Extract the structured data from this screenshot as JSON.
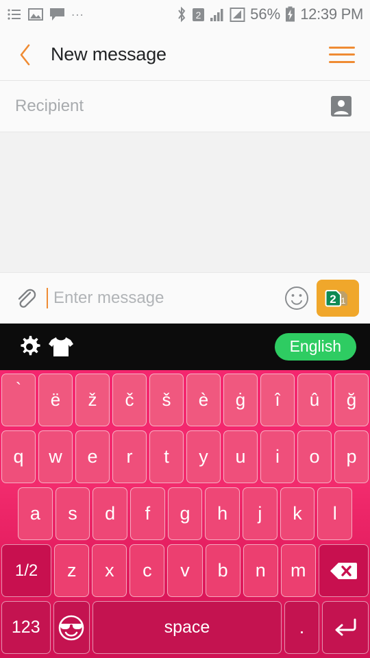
{
  "statusbar": {
    "left_icons": [
      "list-icon",
      "image-icon",
      "message-icon",
      "overflow-dots-icon"
    ],
    "right_icons": [
      "bluetooth-icon",
      "sim2-icon",
      "signal-icon",
      "signal-secondary-icon",
      "battery-charging-icon"
    ],
    "overflow": "...",
    "battery_percent": "56%",
    "time": "12:39 PM"
  },
  "appbar": {
    "back_icon": "chevron-left-icon",
    "title": "New message",
    "menu_icon": "hamburger-menu-icon",
    "accent_color": "#ef8b33"
  },
  "recipient": {
    "placeholder": "Recipient",
    "value": "",
    "contact_icon": "contact-picker-icon"
  },
  "compose": {
    "attach_icon": "paperclip-icon",
    "placeholder": "Enter message",
    "value": "",
    "emoji_icon": "smiley-face-icon",
    "send": {
      "icon": "sim2-send-icon",
      "sim_label": "2",
      "sim_secondary_label": "1",
      "background": "#f0a72b",
      "sim_color": "#0e8a53"
    }
  },
  "keyboard_toolbar": {
    "settings_icon": "gear-icon",
    "theme_icon": "tshirt-icon",
    "language_label": "English",
    "language_color": "#2ecc62",
    "background": "#0c0c0c"
  },
  "keyboard": {
    "theme_colors": {
      "background_top": "#f4266e",
      "background_bottom": "#cf1254",
      "key_light": "#f0587f",
      "key_dark": "#c41350"
    },
    "rows": [
      {
        "name": "accent-row",
        "keys": [
          {
            "label": "`",
            "name": "key-grave"
          },
          {
            "label": "ë",
            "name": "key-e-diaeresis"
          },
          {
            "label": "ž",
            "name": "key-z-caron"
          },
          {
            "label": "č",
            "name": "key-c-caron"
          },
          {
            "label": "š",
            "name": "key-s-caron"
          },
          {
            "label": "è",
            "name": "key-e-grave"
          },
          {
            "label": "ġ",
            "name": "key-g-dot"
          },
          {
            "label": "î",
            "name": "key-i-circumflex"
          },
          {
            "label": "û",
            "name": "key-u-circumflex"
          },
          {
            "label": "ğ",
            "name": "key-g-breve"
          }
        ]
      },
      {
        "name": "qwerty-row",
        "keys": [
          {
            "label": "q",
            "name": "key-q"
          },
          {
            "label": "w",
            "name": "key-w"
          },
          {
            "label": "e",
            "name": "key-e"
          },
          {
            "label": "r",
            "name": "key-r"
          },
          {
            "label": "t",
            "name": "key-t"
          },
          {
            "label": "y",
            "name": "key-y"
          },
          {
            "label": "u",
            "name": "key-u"
          },
          {
            "label": "i",
            "name": "key-i"
          },
          {
            "label": "o",
            "name": "key-o"
          },
          {
            "label": "p",
            "name": "key-p"
          }
        ]
      },
      {
        "name": "asdf-row",
        "keys": [
          {
            "label": "a",
            "name": "key-a"
          },
          {
            "label": "s",
            "name": "key-s"
          },
          {
            "label": "d",
            "name": "key-d"
          },
          {
            "label": "f",
            "name": "key-f"
          },
          {
            "label": "g",
            "name": "key-g"
          },
          {
            "label": "h",
            "name": "key-h"
          },
          {
            "label": "j",
            "name": "key-j"
          },
          {
            "label": "k",
            "name": "key-k"
          },
          {
            "label": "l",
            "name": "key-l"
          }
        ]
      },
      {
        "name": "zxcv-row",
        "keys": [
          {
            "label": "1/2",
            "name": "key-page-toggle"
          },
          {
            "label": "z",
            "name": "key-z"
          },
          {
            "label": "x",
            "name": "key-x"
          },
          {
            "label": "c",
            "name": "key-c"
          },
          {
            "label": "v",
            "name": "key-v"
          },
          {
            "label": "b",
            "name": "key-b"
          },
          {
            "label": "n",
            "name": "key-n"
          },
          {
            "label": "m",
            "name": "key-m"
          },
          {
            "label": "",
            "name": "key-backspace",
            "icon": "backspace-icon"
          }
        ]
      },
      {
        "name": "bottom-row",
        "keys": [
          {
            "label": "123",
            "name": "key-numeric"
          },
          {
            "label": "",
            "name": "key-emoji",
            "icon": "sunglasses-emoji-icon"
          },
          {
            "label": "space",
            "name": "key-space"
          },
          {
            "label": ".",
            "name": "key-period"
          },
          {
            "label": "",
            "name": "key-enter",
            "icon": "enter-return-icon"
          }
        ]
      }
    ]
  }
}
